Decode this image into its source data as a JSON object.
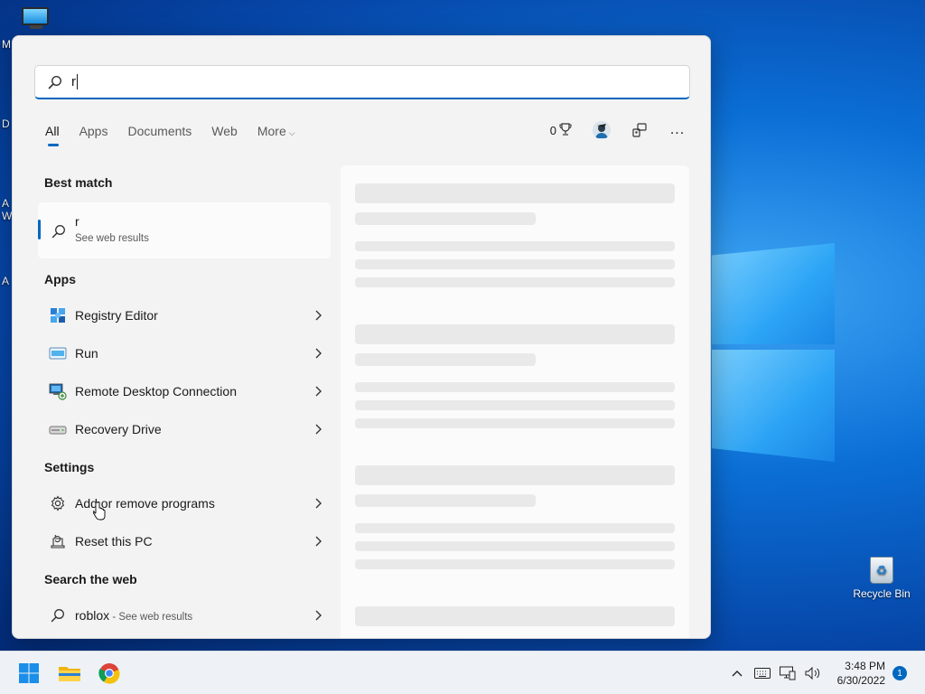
{
  "desktop": {
    "edge_labels": [
      "M",
      "D",
      "A",
      "W",
      "A"
    ],
    "recycle_bin_label": "Recycle Bin"
  },
  "search": {
    "query": "r"
  },
  "tabs": [
    {
      "label": "All",
      "active": true
    },
    {
      "label": "Apps",
      "active": false
    },
    {
      "label": "Documents",
      "active": false
    },
    {
      "label": "Web",
      "active": false
    },
    {
      "label": "More",
      "active": false
    }
  ],
  "toolbar": {
    "points": "0",
    "more_options": "..."
  },
  "sections": {
    "best_match": "Best match",
    "apps": "Apps",
    "settings": "Settings",
    "search_web": "Search the web"
  },
  "best_match": {
    "title": "r",
    "subtitle": "See web results"
  },
  "apps": [
    {
      "label": "Registry Editor",
      "icon": "registry-editor-icon"
    },
    {
      "label": "Run",
      "icon": "run-icon"
    },
    {
      "label": "Remote Desktop Connection",
      "icon": "remote-desktop-icon"
    },
    {
      "label": "Recovery Drive",
      "icon": "recovery-drive-icon"
    }
  ],
  "settings": [
    {
      "label": "Add or remove programs",
      "icon": "gear-icon"
    },
    {
      "label": "Reset this PC",
      "icon": "reset-pc-icon"
    }
  ],
  "web": {
    "query": "roblox",
    "suffix": " - See web results"
  },
  "taskbar": {
    "time": "3:48 PM",
    "date": "6/30/2022",
    "notification_count": "1"
  },
  "colors": {
    "accent": "#0067c0",
    "panel_bg": "#f3f3f3",
    "taskbar_bg": "#eef2f6"
  }
}
